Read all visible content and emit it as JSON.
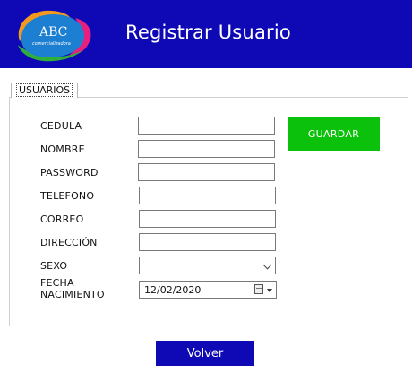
{
  "header": {
    "title": "Registrar Usuario",
    "logo_text": "ABC",
    "logo_sub": "comercializadora",
    "background": "#0e09b5"
  },
  "tab": {
    "label": "USUARIOS"
  },
  "form": {
    "fields": [
      {
        "label": "CEDULA",
        "value": ""
      },
      {
        "label": "NOMBRE",
        "value": ""
      },
      {
        "label": "PASSWORD",
        "value": ""
      },
      {
        "label": "TELEFONO",
        "value": ""
      },
      {
        "label": "CORREO",
        "value": ""
      },
      {
        "label": "DIRECCIÓN",
        "value": ""
      }
    ],
    "sexo": {
      "label": "SEXO",
      "value": ""
    },
    "fecha": {
      "label_line1": "FECHA",
      "label_line2": "NACIMIENTO",
      "value": "12/02/2020"
    }
  },
  "buttons": {
    "guardar": "GUARDAR",
    "guardar_color": "#0cc10c",
    "volver": "Volver"
  }
}
